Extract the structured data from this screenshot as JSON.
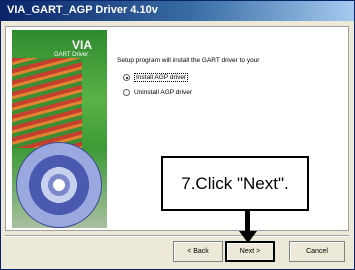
{
  "window": {
    "title": "VIA_GART_AGP Driver 4.10v"
  },
  "banner": {
    "logo": "VIA",
    "subtitle": "GART Driver"
  },
  "content": {
    "description": "Setup program will install the GART driver to your",
    "options": [
      {
        "label": "Install AGP driver",
        "selected": true
      },
      {
        "label": "Uninstall AGP driver",
        "selected": false
      }
    ]
  },
  "callout": {
    "text": "7.Click \"Next\"."
  },
  "buttons": {
    "back": "< Back",
    "next": "Next >",
    "cancel": "Cancel"
  }
}
